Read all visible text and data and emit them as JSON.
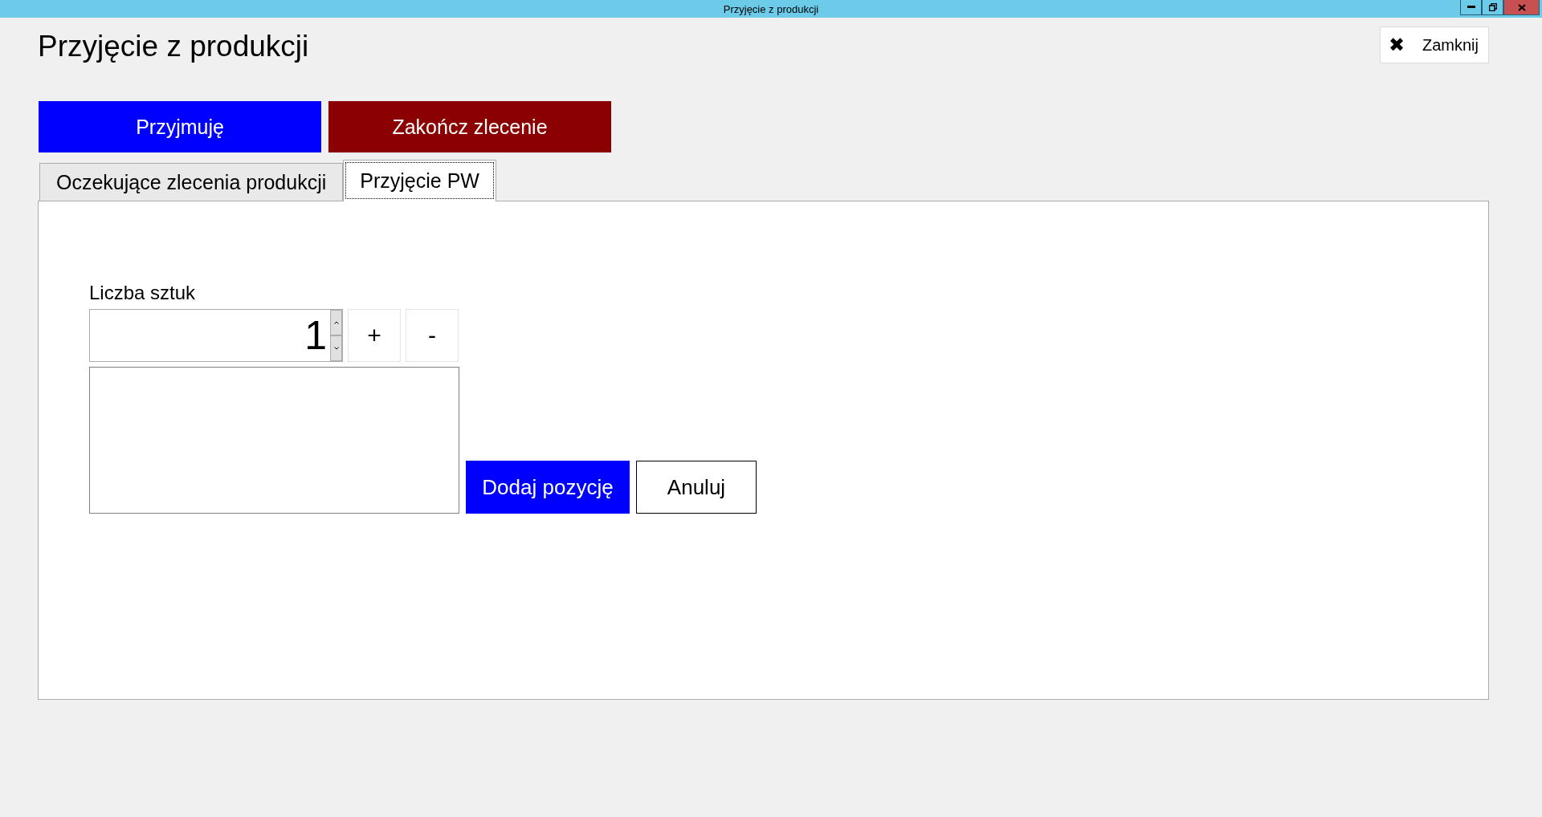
{
  "window": {
    "title": "Przyjęcie z produkcji"
  },
  "heading": "Przyjęcie z produkcji",
  "close_button": {
    "label": "Zamknij",
    "icon": "✖"
  },
  "actions": [
    {
      "label": "Przyjmuję",
      "kind": "primary"
    },
    {
      "label": "Zakończ zlecenie",
      "kind": "danger"
    }
  ],
  "tabs": [
    {
      "label": "Oczekujące zlecenia produkcji",
      "selected": false
    },
    {
      "label": "Przyjęcie PW",
      "selected": true
    }
  ],
  "quantity": {
    "label": "Liczba sztuk",
    "value": "1",
    "increment": "+",
    "decrement": "-"
  },
  "form_buttons": [
    {
      "label": "Dodaj pozycję",
      "kind": "primary"
    },
    {
      "label": "Anuluj",
      "kind": "plain"
    }
  ]
}
